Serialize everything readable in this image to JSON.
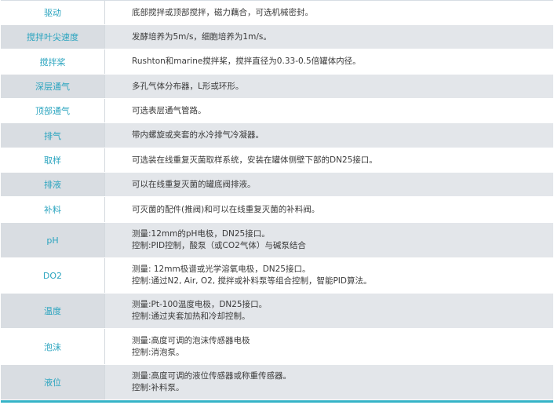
{
  "rows": [
    {
      "label": "驱动",
      "lines": [
        "底部搅拌或顶部搅拌，磁力藕合，可选机械密封。"
      ]
    },
    {
      "label": "搅拌叶尖速度",
      "lines": [
        "发酵培养为5m/s，细胞培养为1m/s。"
      ]
    },
    {
      "label": "搅拌桨",
      "lines": [
        "Rushton和marine搅拌桨，搅拌直径为0.33-0.5倍罐体内径。"
      ]
    },
    {
      "label": "深层通气",
      "lines": [
        "多孔气体分布器，L形或环形。"
      ]
    },
    {
      "label": "顶部通气",
      "lines": [
        "可选表层通气管路。"
      ]
    },
    {
      "label": "排气",
      "lines": [
        "带内螺旋或夹套的水冷排气冷凝器。"
      ]
    },
    {
      "label": "取样",
      "lines": [
        "可选装在线重复灭菌取样系统，安装在罐体侧壁下部的DN25接口。"
      ]
    },
    {
      "label": "排液",
      "lines": [
        "可以在线重复灭菌的罐底阀排液。"
      ]
    },
    {
      "label": "补料",
      "lines": [
        "可灭菌的配件(推阀)和可以在线重复灭菌的补料阀。"
      ]
    },
    {
      "label": "pH",
      "lines": [
        "测量:12mm的pH电极，DN25接口。",
        "控制:PID控制，酸泵（或CO2气体）与碱泵结合"
      ]
    },
    {
      "label": "DO2",
      "lines": [
        "测量: 12mm极谱或光学溶氧电极，DN25接口。",
        "控制:通过N2, Air, O2, 搅拌或补料泵等组合控制，智能PID算法。"
      ]
    },
    {
      "label": "温度",
      "lines": [
        "测量:Pt-100温度电极，DN25接口。",
        "控制:通过夹套加热和冷却控制。"
      ]
    },
    {
      "label": "泡沫",
      "lines": [
        "测量:高度可调的泡沫传感器电极",
        "控制:消泡泵。"
      ]
    },
    {
      "label": "液位",
      "lines": [
        "测量:高度可调的液位传感器或称重传感器。",
        "控制:补料泵。"
      ]
    }
  ]
}
